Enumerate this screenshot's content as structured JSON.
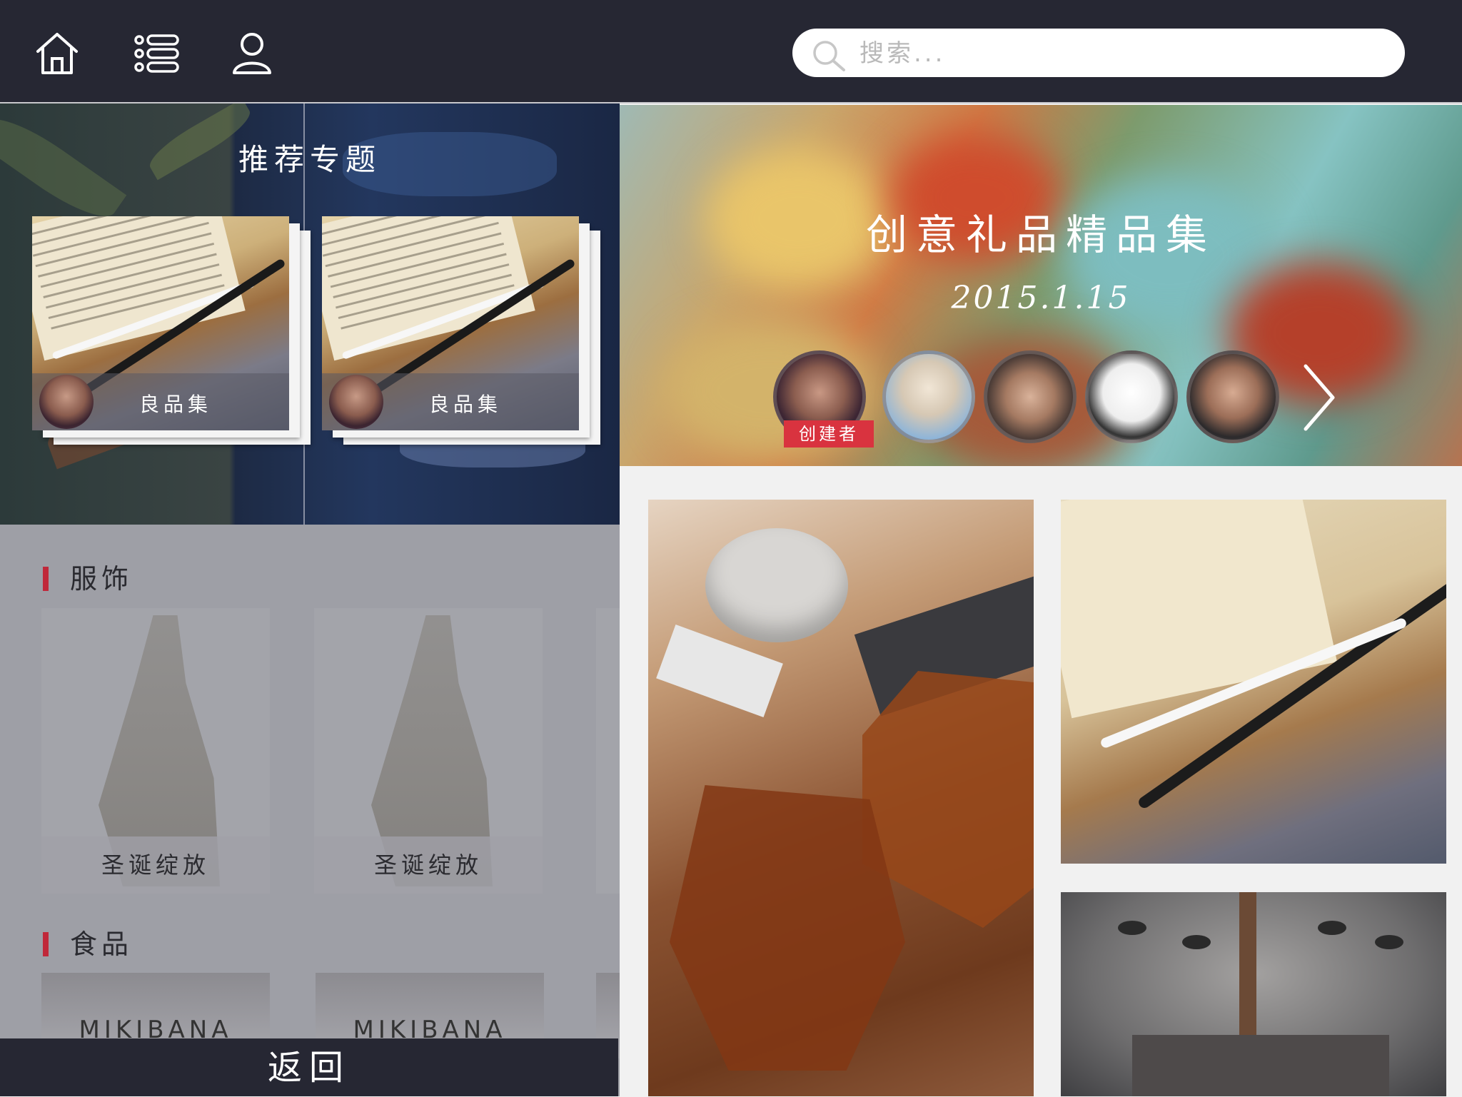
{
  "topbar": {
    "icons": [
      "home-icon",
      "list-icon",
      "user-icon"
    ],
    "search_placeholder": "搜索..."
  },
  "recommend": {
    "title": "推荐专题",
    "cards": [
      {
        "label": "良品集"
      },
      {
        "label": "良品集"
      }
    ]
  },
  "categories": [
    {
      "title": "服饰",
      "tiles": [
        "圣诞绽放",
        "圣诞绽放"
      ]
    },
    {
      "title": "食品",
      "tiles": [
        "MIKIBANA",
        "MIKIBANA"
      ]
    }
  ],
  "back_label": "返回",
  "banner": {
    "title": "创意礼品精品集",
    "date": "2015.1.15",
    "creator_tag": "创建者",
    "member_count_visible": 5
  },
  "colors": {
    "topbar": "#262733",
    "accent_red": "#d9333f",
    "section_mark": "#c0283a"
  }
}
